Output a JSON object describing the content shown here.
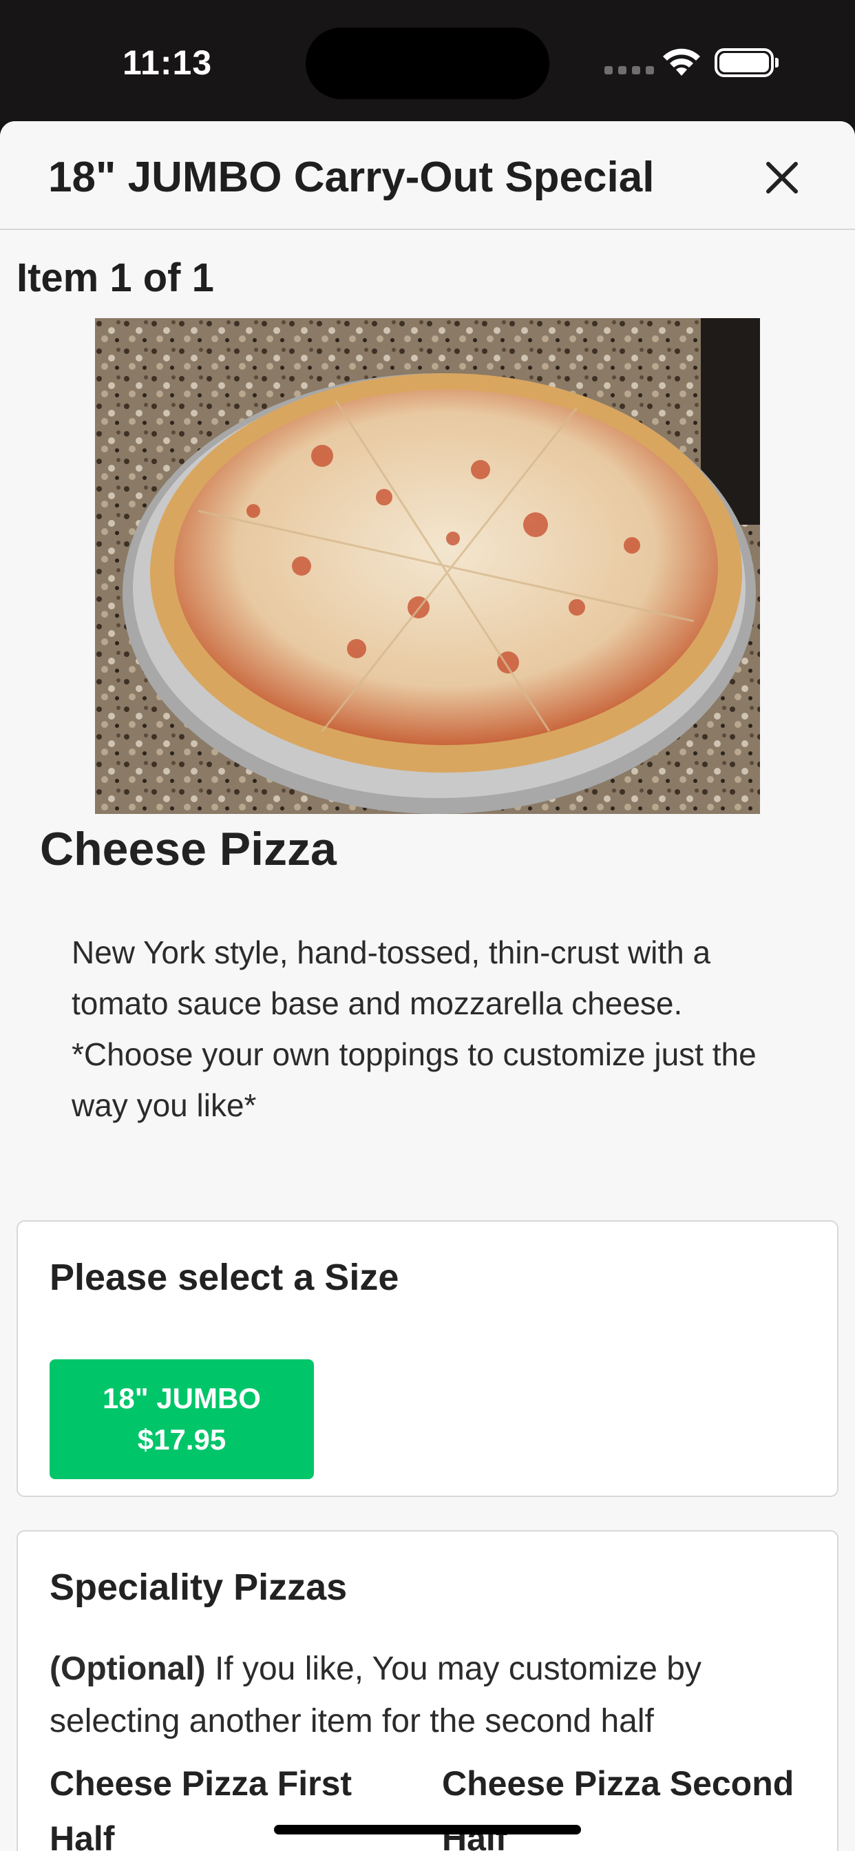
{
  "status_bar": {
    "time": "11:13"
  },
  "header": {
    "title": "18\" JUMBO Carry-Out Special",
    "close_icon": "close-icon"
  },
  "item": {
    "counter": "Item 1 of 1",
    "name": "Cheese Pizza",
    "description": "New York style, hand-tossed, thin-crust with a tomato sauce base and mozzarella cheese. *Choose your own toppings to customize just the way you like*"
  },
  "size_section": {
    "title": "Please select a Size",
    "options": [
      {
        "name": "18\" JUMBO",
        "price": "$17.95",
        "selected": true
      }
    ]
  },
  "speciality_section": {
    "title": "Speciality Pizzas",
    "optional_label": "(Optional)",
    "helper_text": " If you like, You may customize by selecting another item for the second half",
    "first_half_label": "Cheese Pizza First Half",
    "second_half_label": "Cheese Pizza Second Half"
  },
  "colors": {
    "accent": "#00c569",
    "status_bar": "#171515",
    "background": "#f7f7f7"
  }
}
